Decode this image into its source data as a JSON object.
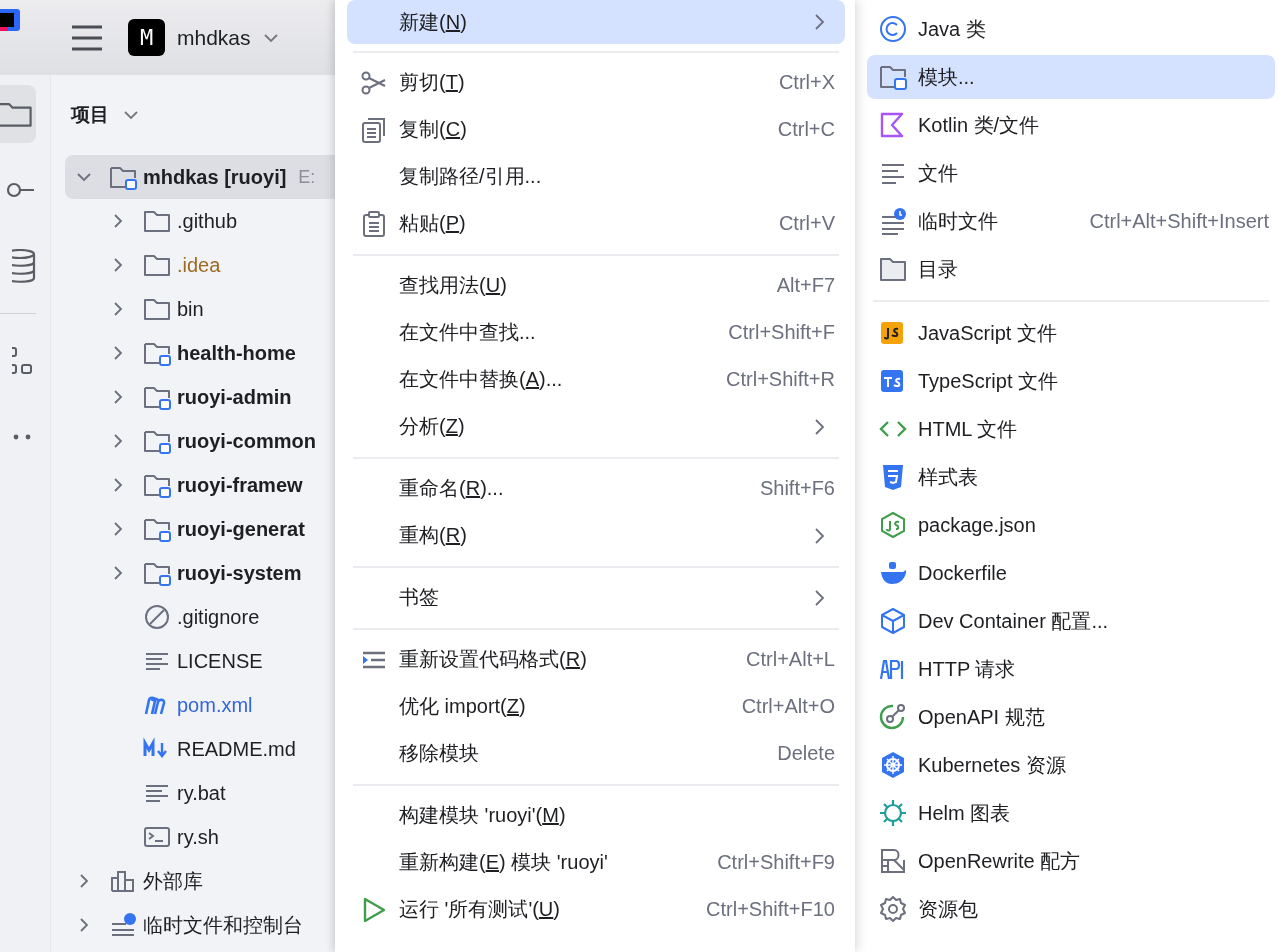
{
  "header": {
    "project_badge": "M",
    "project_name": "mhdkas"
  },
  "tool_strip": [
    {
      "kind": "folder",
      "selected": true
    },
    {
      "kind": "commit",
      "selected": false
    },
    {
      "kind": "database",
      "selected": false
    },
    {
      "kind": "structure",
      "selected": false
    },
    {
      "kind": "more",
      "selected": false
    }
  ],
  "project_panel": {
    "title": "项目",
    "tree": [
      {
        "label": "mhdkas [ruoyi]",
        "path": "E:",
        "kind": "module",
        "bold": true,
        "expanded": true,
        "selected": true,
        "children": [
          {
            "label": ".github",
            "kind": "folder",
            "bold": false,
            "expanded": false,
            "selected": false
          },
          {
            "label": ".idea",
            "kind": "folder",
            "bold": false,
            "expanded": false,
            "selected": false,
            "color": "#9e6a23"
          },
          {
            "label": "bin",
            "kind": "folder",
            "bold": false,
            "expanded": false,
            "selected": false
          },
          {
            "label": "health-home",
            "kind": "module",
            "bold": true,
            "expanded": false,
            "selected": false
          },
          {
            "label": "ruoyi-admin",
            "kind": "module",
            "bold": true,
            "expanded": false,
            "selected": false
          },
          {
            "label": "ruoyi-common",
            "kind": "module",
            "bold": true,
            "expanded": false,
            "selected": false
          },
          {
            "label": "ruoyi-framew",
            "kind": "module",
            "bold": true,
            "expanded": false,
            "selected": false
          },
          {
            "label": "ruoyi-generat",
            "kind": "module",
            "bold": true,
            "expanded": false,
            "selected": false
          },
          {
            "label": "ruoyi-system",
            "kind": "module",
            "bold": true,
            "expanded": false,
            "selected": false
          },
          {
            "label": ".gitignore",
            "kind": "ignore",
            "bold": false,
            "selected": false
          },
          {
            "label": "LICENSE",
            "kind": "text",
            "bold": false,
            "selected": false
          },
          {
            "label": "pom.xml",
            "kind": "maven",
            "bold": false,
            "selected": false,
            "color": "#3366dd"
          },
          {
            "label": "README.md",
            "kind": "markdown",
            "bold": false,
            "selected": false
          },
          {
            "label": "ry.bat",
            "kind": "text",
            "bold": false,
            "selected": false
          },
          {
            "label": "ry.sh",
            "kind": "shell",
            "bold": false,
            "selected": false
          }
        ]
      },
      {
        "label": "外部库",
        "kind": "library",
        "bold": false,
        "expanded": false,
        "selected": false
      },
      {
        "label": "临时文件和控制台",
        "kind": "scratch",
        "bold": false,
        "expanded": false,
        "selected": false
      }
    ]
  },
  "context_menu": [
    [
      {
        "before": "新建(",
        "mnemonic": "N",
        "after": ")",
        "submenu": true,
        "selected": true
      }
    ],
    [
      {
        "kind": "cut",
        "before": "剪切(",
        "mnemonic": "T",
        "after": ")",
        "shortcut": "Ctrl+X",
        "selected": false
      },
      {
        "kind": "copy",
        "before": "复制(",
        "mnemonic": "C",
        "after": ")",
        "shortcut": "Ctrl+C",
        "selected": false
      },
      {
        "before": "复制路径/引用...",
        "selected": false
      },
      {
        "kind": "paste",
        "before": "粘贴(",
        "mnemonic": "P",
        "after": ")",
        "shortcut": "Ctrl+V",
        "selected": false
      }
    ],
    [
      {
        "before": "查找用法(",
        "mnemonic": "U",
        "after": ")",
        "shortcut": "Alt+F7",
        "selected": false
      },
      {
        "before": "在文件中查找...",
        "shortcut": "Ctrl+Shift+F",
        "selected": false
      },
      {
        "before": "在文件中替换(",
        "mnemonic": "A",
        "after": ")...",
        "shortcut": "Ctrl+Shift+R",
        "selected": false
      },
      {
        "before": "分析(",
        "mnemonic": "Z",
        "after": ")",
        "submenu": true,
        "selected": false
      }
    ],
    [
      {
        "before": "重命名(",
        "mnemonic": "R",
        "after": ")...",
        "shortcut": "Shift+F6",
        "selected": false
      },
      {
        "before": "重构(",
        "mnemonic": "R",
        "after": ")",
        "submenu": true,
        "selected": false
      }
    ],
    [
      {
        "before": "书签",
        "submenu": true,
        "selected": false
      }
    ],
    [
      {
        "kind": "reformat",
        "before": "重新设置代码格式(",
        "mnemonic": "R",
        "after": ")",
        "shortcut": "Ctrl+Alt+L",
        "selected": false
      },
      {
        "before": "优化 import(",
        "mnemonic": "Z",
        "after": ")",
        "shortcut": "Ctrl+Alt+O",
        "selected": false
      },
      {
        "before": "移除模块",
        "shortcut": "Delete",
        "selected": false
      }
    ],
    [
      {
        "before": "构建模块 'ruoyi'(",
        "mnemonic": "M",
        "after": ")",
        "selected": false
      },
      {
        "before": "重新构建(",
        "mnemonic": "E",
        "after": ") 模块 'ruoyi'",
        "shortcut": "Ctrl+Shift+F9",
        "selected": false
      },
      {
        "kind": "run",
        "before": "运行 '所有测试'(",
        "mnemonic": "U",
        "after": ")",
        "shortcut": "Ctrl+Shift+F10",
        "selected": false
      }
    ]
  ],
  "new_submenu": [
    [
      {
        "kind": "java",
        "label": "Java 类",
        "selected": false
      },
      {
        "kind": "module",
        "label": "模块...",
        "selected": true
      },
      {
        "kind": "kotlin",
        "label": "Kotlin 类/文件",
        "selected": false
      },
      {
        "kind": "text",
        "label": "文件",
        "selected": false
      },
      {
        "kind": "scratch",
        "label": "临时文件",
        "shortcut": "Ctrl+Alt+Shift+Insert",
        "selected": false
      },
      {
        "kind": "folder",
        "label": "目录",
        "selected": false
      }
    ],
    [
      {
        "kind": "js",
        "label": "JavaScript 文件",
        "selected": false
      },
      {
        "kind": "ts",
        "label": "TypeScript 文件",
        "selected": false
      },
      {
        "kind": "html",
        "label": "HTML 文件",
        "selected": false
      },
      {
        "kind": "css",
        "label": "样式表",
        "selected": false
      },
      {
        "kind": "node",
        "label": "package.json",
        "selected": false
      },
      {
        "kind": "docker",
        "label": "Dockerfile",
        "selected": false
      },
      {
        "kind": "cube",
        "label": "Dev Container 配置...",
        "selected": false
      },
      {
        "kind": "api",
        "label": "HTTP 请求",
        "selected": false
      },
      {
        "kind": "openapi",
        "label": "OpenAPI 规范",
        "selected": false
      },
      {
        "kind": "k8s",
        "label": "Kubernetes 资源",
        "selected": false
      },
      {
        "kind": "helm",
        "label": "Helm 图表",
        "selected": false
      },
      {
        "kind": "rewrite",
        "label": "OpenRewrite 配方",
        "selected": false
      },
      {
        "kind": "gear",
        "label": "资源包",
        "selected": false
      }
    ]
  ]
}
